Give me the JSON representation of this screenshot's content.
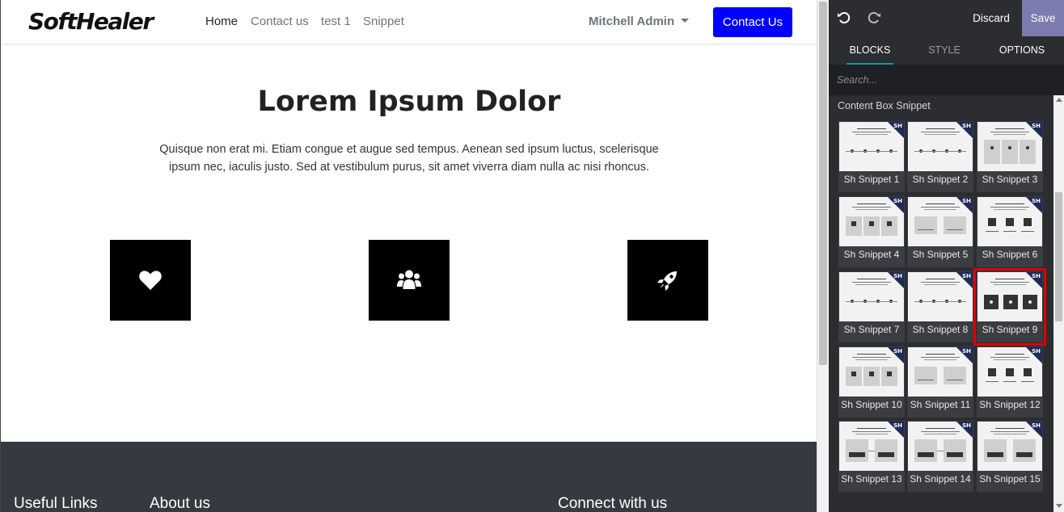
{
  "site": {
    "logo": "SoftHealer",
    "nav": {
      "home": "Home",
      "contact": "Contact us",
      "test": "test 1",
      "snippet": "Snippet"
    },
    "user": "Mitchell Admin",
    "contact_button": "Contact Us",
    "hero": {
      "title": "Lorem Ipsum Dolor",
      "text": "Quisque non erat mi. Etiam congue et augue sed tempus. Aenean sed ipsum luctus, scelerisque ipsum nec, iaculis justo. Sed at vestibulum purus, sit amet viverra diam nulla ac nisi rhoncus."
    },
    "features": [
      {
        "icon": "heart-icon"
      },
      {
        "icon": "users-icon"
      },
      {
        "icon": "rocket-icon"
      }
    ],
    "footer": {
      "useful_links": "Useful Links",
      "about": "About us",
      "connect": "Connect with us"
    }
  },
  "editor": {
    "discard": "Discard",
    "save": "Save",
    "tabs": [
      "BLOCKS",
      "STYLE",
      "OPTIONS"
    ],
    "active_tab": "BLOCKS",
    "search_placeholder": "Search...",
    "section_title": "Content Box Snippet",
    "snippets": [
      "Sh Snippet 1",
      "Sh Snippet 2",
      "Sh Snippet 3",
      "Sh Snippet 4",
      "Sh Snippet 5",
      "Sh Snippet 6",
      "Sh Snippet 7",
      "Sh Snippet 8",
      "Sh Snippet 9",
      "Sh Snippet 10",
      "Sh Snippet 11",
      "Sh Snippet 12",
      "Sh Snippet 13",
      "Sh Snippet 14",
      "Sh Snippet 15"
    ],
    "selected_snippet": "Sh Snippet 9",
    "badge": "SH"
  },
  "colors": {
    "brand_button": "#0000ff",
    "footer": "#343a40",
    "editor_bg": "#2b2d31",
    "save": "#7c7bad",
    "selection": "#e00000"
  }
}
